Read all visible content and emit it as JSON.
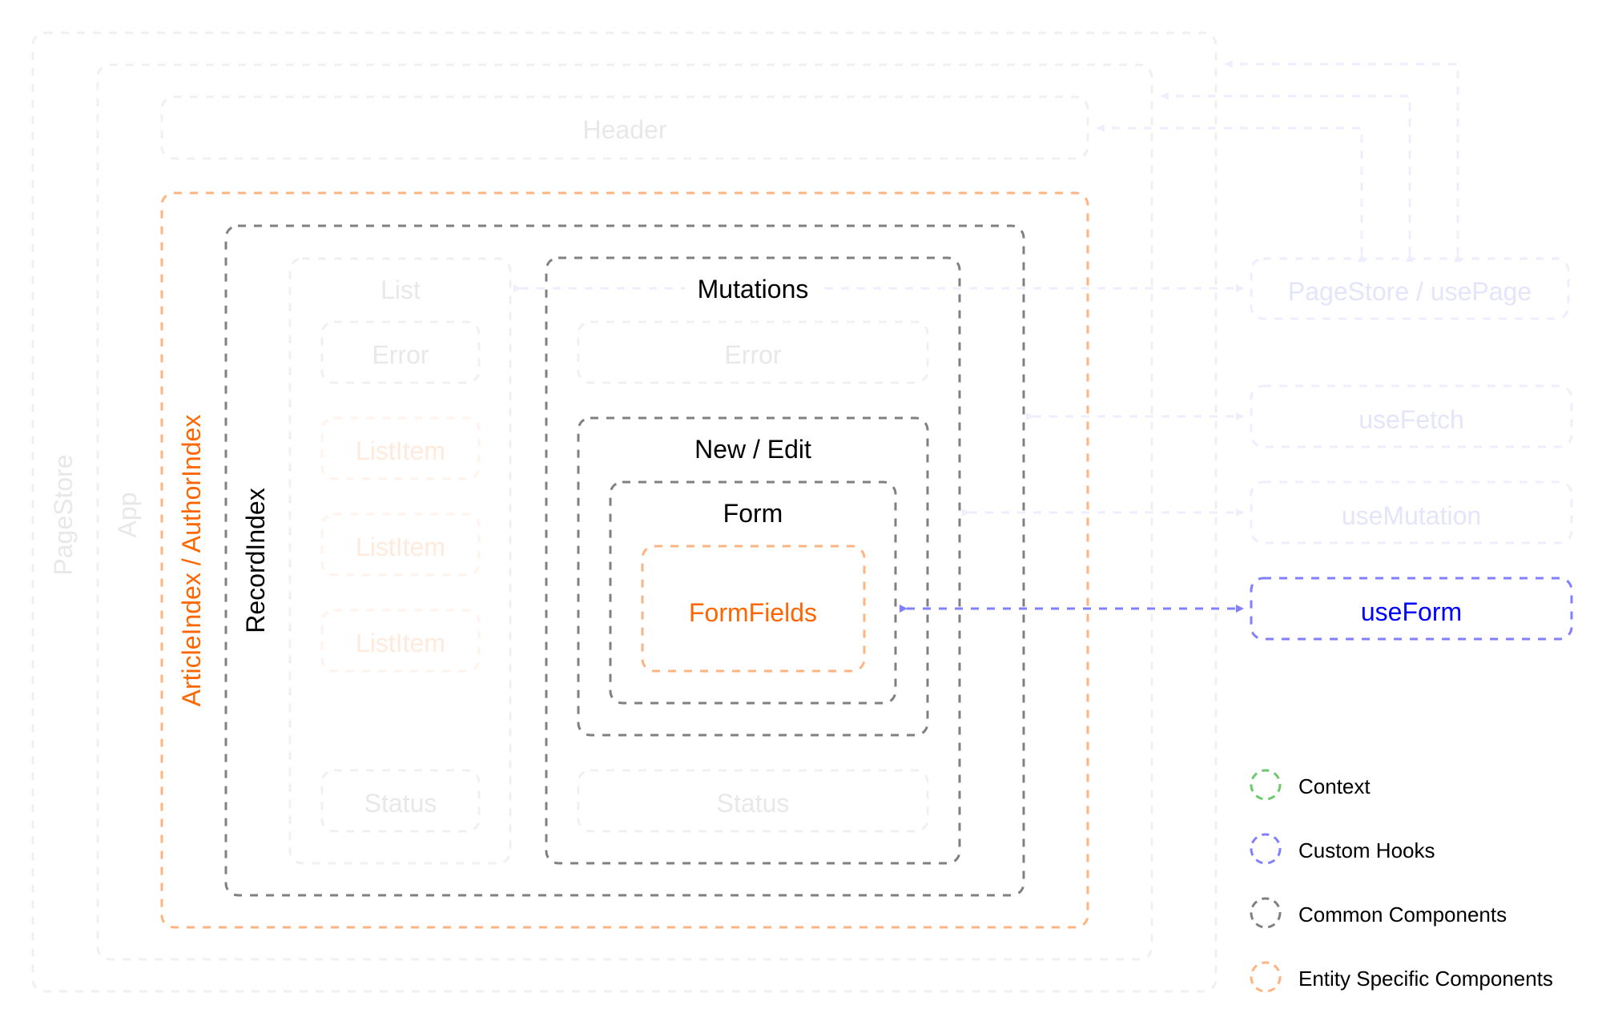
{
  "colors": {
    "context": "#6cc96c",
    "custom_hooks": "#8080ff",
    "common": "#808080",
    "entity": "#ffb380",
    "faded_line": "#f0f0f0",
    "faded_text": "#e8e8e8",
    "faded_hook_line": "#eeeefc",
    "faded_hook_text": "#e4e4fa",
    "faded_entity_line": "#fff3eb",
    "faded_entity_text": "#ffeadb",
    "entity_text": "#ff6600",
    "hook_text": "#0000ff",
    "common_text": "#000000"
  },
  "nodes": {
    "pagestore": {
      "label": "PageStore",
      "kind": "context",
      "faded": true
    },
    "app": {
      "label": "App",
      "kind": "common",
      "faded": true
    },
    "header": {
      "label": "Header",
      "kind": "common",
      "faded": true
    },
    "entity_index": {
      "label": "ArticleIndex / AuthorIndex",
      "kind": "entity",
      "faded": false
    },
    "record_index": {
      "label": "RecordIndex",
      "kind": "common",
      "faded": false
    },
    "list": {
      "label": "List",
      "kind": "common",
      "faded": true
    },
    "list_error": {
      "label": "Error",
      "kind": "common",
      "faded": true
    },
    "list_items": [
      {
        "label": "ListItem",
        "kind": "entity",
        "faded": true
      },
      {
        "label": "ListItem",
        "kind": "entity",
        "faded": true
      },
      {
        "label": "ListItem",
        "kind": "entity",
        "faded": true
      }
    ],
    "list_status": {
      "label": "Status",
      "kind": "common",
      "faded": true
    },
    "mutations": {
      "label": "Mutations",
      "kind": "common",
      "faded": false
    },
    "mutations_error": {
      "label": "Error",
      "kind": "common",
      "faded": true
    },
    "new_edit": {
      "label": "New / Edit",
      "kind": "common",
      "faded": false
    },
    "form": {
      "label": "Form",
      "kind": "common",
      "faded": false
    },
    "form_fields": {
      "label": "FormFields",
      "kind": "entity",
      "faded": false
    },
    "mutations_status": {
      "label": "Status",
      "kind": "common",
      "faded": true
    },
    "use_page": {
      "label": "PageStore / usePage",
      "kind": "hook",
      "faded": true
    },
    "use_fetch": {
      "label": "useFetch",
      "kind": "hook",
      "faded": true
    },
    "use_mutation": {
      "label": "useMutation",
      "kind": "hook",
      "faded": true
    },
    "use_form": {
      "label": "useForm",
      "kind": "hook",
      "faded": false
    }
  },
  "connections": [
    {
      "from": "use_page",
      "to": "pagestore",
      "direction": "one-way",
      "faded": true
    },
    {
      "from": "use_page",
      "to": "app",
      "direction": "one-way",
      "faded": true
    },
    {
      "from": "use_page",
      "to": "header",
      "direction": "one-way",
      "faded": true
    },
    {
      "from": "list",
      "to": "use_page",
      "direction": "two-way",
      "faded": true
    },
    {
      "from": "record_index",
      "to": "use_fetch",
      "direction": "two-way",
      "faded": true
    },
    {
      "from": "mutations",
      "to": "use_mutation",
      "direction": "one-way-to-hook-with-return",
      "faded": true
    },
    {
      "from": "form_fields",
      "to": "use_form",
      "direction": "two-way",
      "faded": false
    }
  ],
  "legend": [
    {
      "label": "Context",
      "kind": "context"
    },
    {
      "label": "Custom Hooks",
      "kind": "custom_hooks"
    },
    {
      "label": "Common Components",
      "kind": "common"
    },
    {
      "label": "Entity Specific Components",
      "kind": "entity"
    }
  ]
}
